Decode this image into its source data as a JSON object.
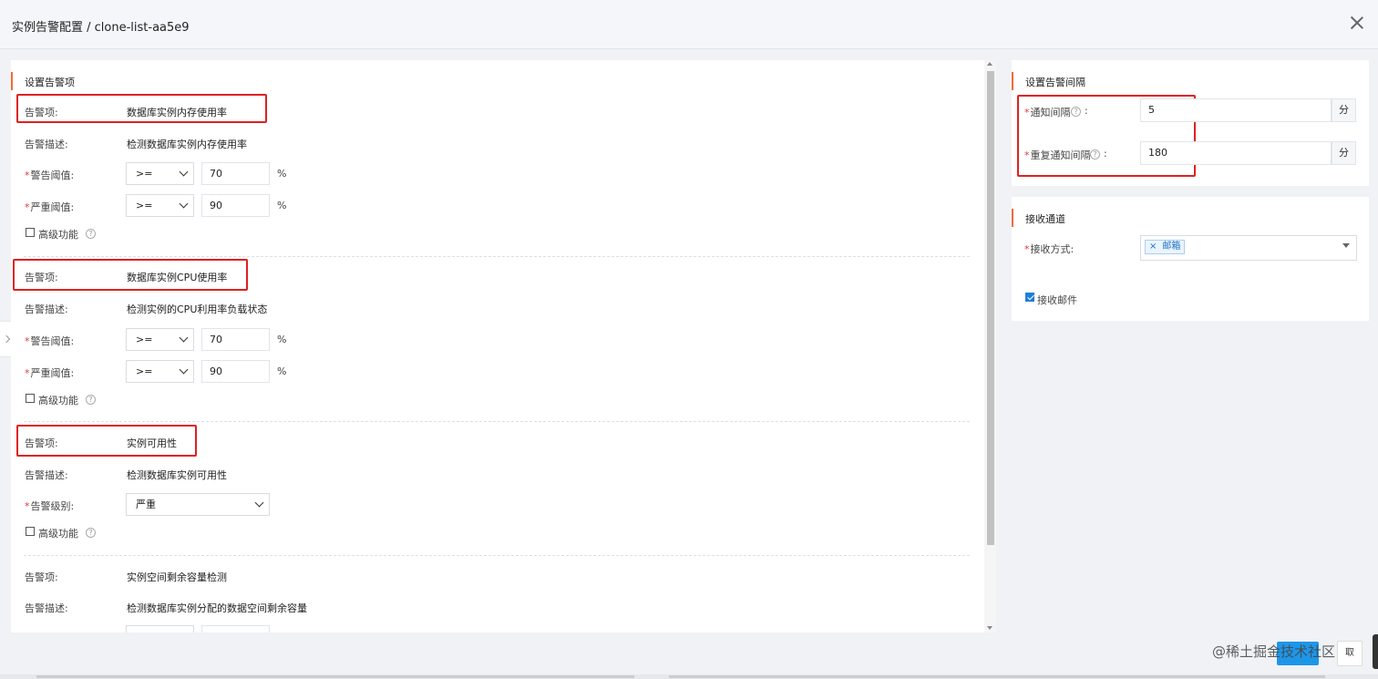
{
  "dialog": {
    "title": "实例告警配置 / clone-list-aa5e9"
  },
  "alert_items": {
    "section_title": "设置告警项",
    "item1": {
      "item_label": "告警项:",
      "item_value": "数据库实例内存使用率",
      "desc_label": "告警描述:",
      "desc_value": "检测数据库实例内存使用率",
      "warn_label": "警告阈值:",
      "warn_op": ">=",
      "warn_value": "70",
      "warn_unit": "%",
      "crit_label": "严重阈值:",
      "crit_op": ">=",
      "crit_value": "90",
      "crit_unit": "%",
      "advanced_label": "高级功能"
    },
    "item2": {
      "item_label": "告警项:",
      "item_value": "数据库实例CPU使用率",
      "desc_label": "告警描述:",
      "desc_value": "检测实例的CPU利用率负载状态",
      "warn_label": "警告阈值:",
      "warn_op": ">=",
      "warn_value": "70",
      "warn_unit": "%",
      "crit_label": "严重阈值:",
      "crit_op": ">=",
      "crit_value": "90",
      "crit_unit": "%",
      "advanced_label": "高级功能"
    },
    "item3": {
      "item_label": "告警项:",
      "item_value": "实例可用性",
      "desc_label": "告警描述:",
      "desc_value": "检测数据库实例可用性",
      "level_label": "告警级别:",
      "level_value": "严重",
      "advanced_label": "高级功能"
    },
    "item4": {
      "item_label": "告警项:",
      "item_value": "实例空间剩余容量检测",
      "desc_label": "告警描述:",
      "desc_value": "检测数据库实例分配的数据空间剩余容量"
    },
    "required_mark": "*",
    "help_glyph": "?"
  },
  "interval": {
    "section_title": "设置告警间隔",
    "notify_label": "通知间隔",
    "notify_value": "5",
    "notify_unit": "分",
    "repeat_label": "重复通知间隔",
    "repeat_value": "180",
    "repeat_unit": "分",
    "colon": ":"
  },
  "channel": {
    "section_title": "接收通道",
    "method_label": "接收方式:",
    "tag_remove": "×",
    "tag_label": "邮箱",
    "receive_mail_label": "接收邮件",
    "receive_mail_checked": true
  },
  "footer": {
    "watermark": "@稀土掘金技术社区",
    "cancel_label": "取"
  },
  "colors": {
    "accent": "#f26b3a",
    "highlight": "#e02020",
    "primary": "#1e96e8"
  }
}
